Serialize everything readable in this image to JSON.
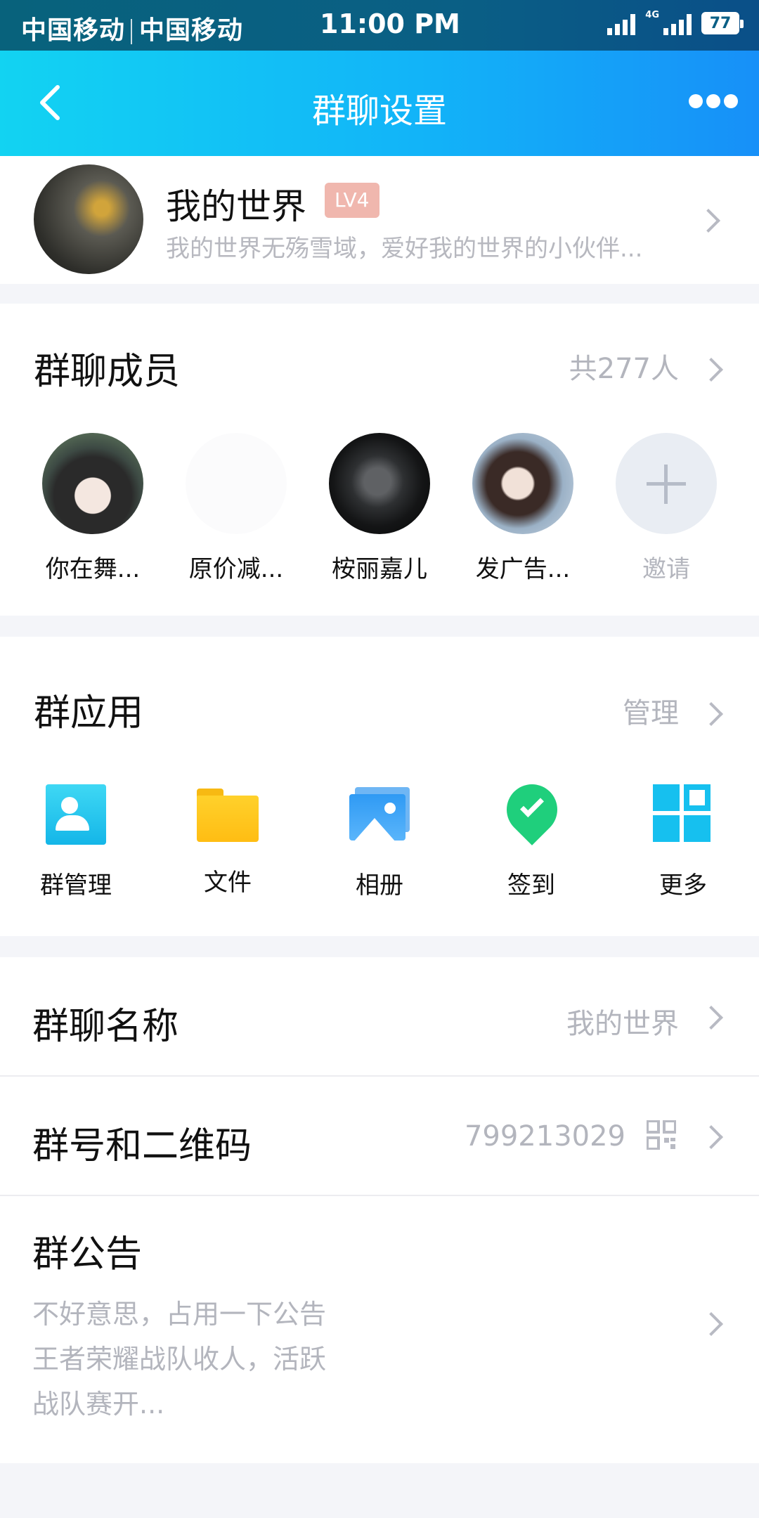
{
  "status_bar": {
    "carrier_1": "中国移动",
    "carrier_2": "中国移动",
    "time": "11:00 PM",
    "network_label": "4G",
    "battery": "77"
  },
  "nav": {
    "title": "群聊设置",
    "back_icon": "chevron-left-icon",
    "more_icon": "more-dots-icon"
  },
  "group": {
    "name": "我的世界",
    "level": "LV4",
    "description": "我的世界无殇雪域，爱好我的世界的小伙伴..."
  },
  "members": {
    "title": "群聊成员",
    "count_label": "共277人",
    "list": [
      {
        "label": "你在舞..."
      },
      {
        "label": "原价减..."
      },
      {
        "label": "桉丽嘉儿"
      },
      {
        "label": "发广告..."
      }
    ],
    "invite_label": "邀请"
  },
  "apps": {
    "title": "群应用",
    "manage_label": "管理",
    "items": [
      {
        "label": "群管理",
        "icon": "group-admin-icon"
      },
      {
        "label": "文件",
        "icon": "folder-icon"
      },
      {
        "label": "相册",
        "icon": "photo-album-icon"
      },
      {
        "label": "签到",
        "icon": "check-in-icon"
      },
      {
        "label": "更多",
        "icon": "grid-more-icon"
      }
    ]
  },
  "settings": {
    "group_name_label": "群聊名称",
    "group_name_value": "我的世界",
    "group_id_label": "群号和二维码",
    "group_id_value": "799213029",
    "notice_label": "群公告",
    "notice_lines": [
      "不好意思，占用一下公告",
      "王者荣耀战队收人，活跃",
      "战队赛开..."
    ]
  },
  "colors": {
    "header_start": "#12d3f2",
    "header_end": "#1790f8",
    "level_badge": "#f0b7ae",
    "muted_text": "#b3b5bd"
  }
}
